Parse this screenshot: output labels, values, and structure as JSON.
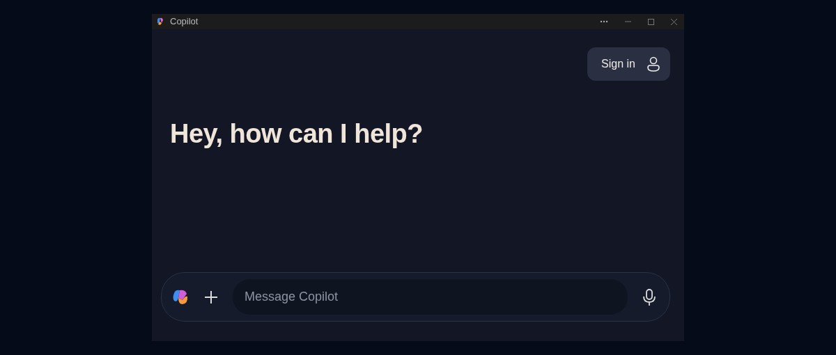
{
  "window": {
    "title": "Copilot"
  },
  "header": {
    "sign_in": "Sign in"
  },
  "greeting": "Hey, how can I help?",
  "composer": {
    "placeholder": "Message Copilot"
  }
}
